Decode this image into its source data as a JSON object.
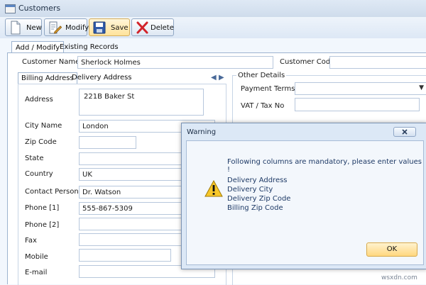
{
  "window": {
    "title": "Customers"
  },
  "toolbar": {
    "new_label": "New",
    "modify_label": "Modify",
    "save_label": "Save",
    "delete_label": "Delete"
  },
  "tabs": {
    "add_modify": "Add / Modify",
    "existing_records": "Existing Records"
  },
  "customer": {
    "name_label": "Customer Name",
    "name_value": "Sherlock Holmes",
    "code_label": "Customer Code",
    "code_value": ""
  },
  "address_tabs": {
    "billing": "Billing Address",
    "delivery": "Delivery Address"
  },
  "billing": {
    "address_label": "Address",
    "address_value": "221B Baker St",
    "city_label": "City Name",
    "city_value": "London",
    "zip_label": "Zip Code",
    "zip_value": "",
    "state_label": "State",
    "state_value": "",
    "country_label": "Country",
    "country_value": "UK",
    "contact_label": "Contact Person",
    "contact_value": "Dr. Watson",
    "phone1_label": "Phone [1]",
    "phone1_value": "555-867-5309",
    "phone2_label": "Phone [2]",
    "phone2_value": "",
    "fax_label": "Fax",
    "fax_value": "",
    "mobile_label": "Mobile",
    "mobile_value": "",
    "email_label": "E-mail",
    "email_value": ""
  },
  "other_details": {
    "title": "Other Details",
    "payment_terms_label": "Payment Terms",
    "payment_terms_value": "",
    "vat_label": "VAT / Tax No",
    "vat_value": ""
  },
  "dialog": {
    "title": "Warning",
    "message": "Following columns are mandatory, please enter values !",
    "fields": [
      "Delivery Address",
      "Delivery City",
      "Delivery Zip Code",
      "Billing Zip Code"
    ],
    "ok_label": "OK"
  },
  "watermark": "wsxdn.com"
}
